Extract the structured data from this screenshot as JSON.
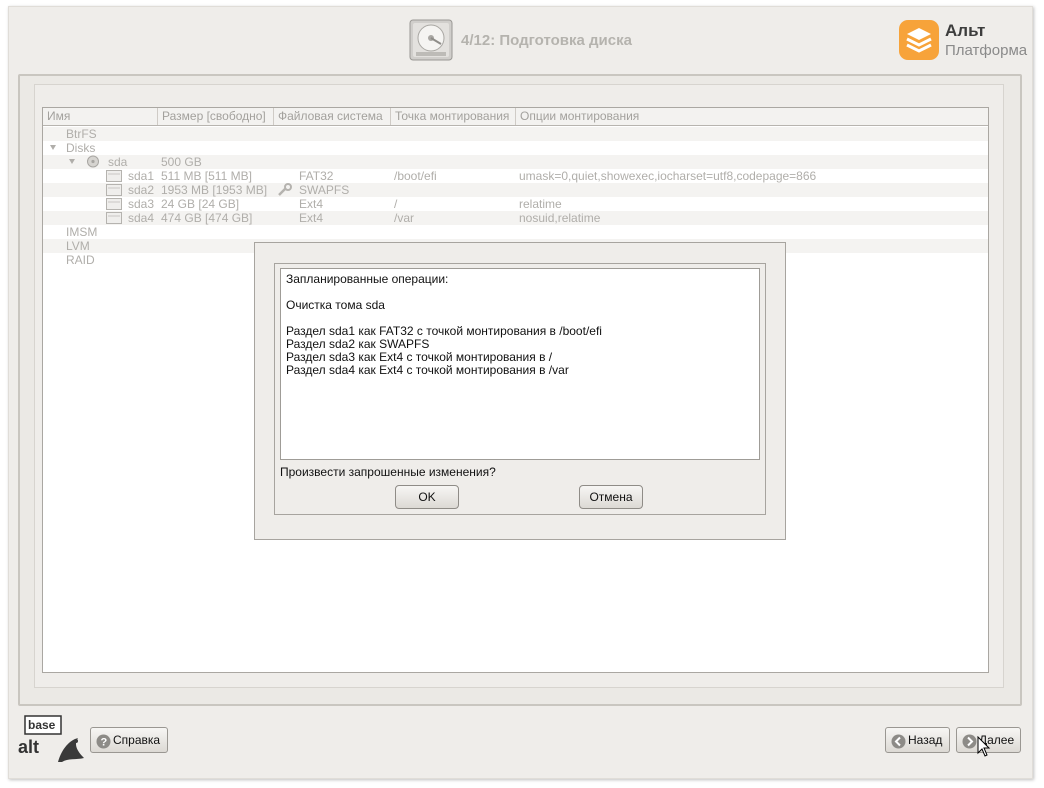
{
  "header": {
    "title": "4/12: Подготовка диска",
    "logo_line1": "Альт",
    "logo_line2": "Платформа"
  },
  "tree": {
    "columns": [
      "Имя",
      "Размер [свободно]",
      "Файловая система",
      "Точка монтирования",
      "Опции монтирования"
    ],
    "rows": [
      {
        "name": "BtrFS"
      },
      {
        "name": "Disks"
      },
      {
        "name": "sda",
        "size": "500 GB"
      },
      {
        "name": "sda1",
        "size": "511 MB [511 MB]",
        "fs": "FAT32",
        "mount": "/boot/efi",
        "options": "umask=0,quiet,showexec,iocharset=utf8,codepage=866"
      },
      {
        "name": "sda2",
        "size": "1953 MB [1953 MB]",
        "fs": "SWAPFS",
        "mount": "",
        "options": ""
      },
      {
        "name": "sda3",
        "size": "24 GB [24 GB]",
        "fs": "Ext4",
        "mount": "/",
        "options": "relatime"
      },
      {
        "name": "sda4",
        "size": "474 GB [474 GB]",
        "fs": "Ext4",
        "mount": "/var",
        "options": "nosuid,relatime"
      },
      {
        "name": "IMSM"
      },
      {
        "name": "LVM"
      },
      {
        "name": "RAID"
      }
    ]
  },
  "dialog": {
    "ops_title": "Запланированные операции:",
    "op_clear": "Очистка тома sda",
    "op_lines": [
      "Раздел sda1 как FAT32 с точкой монтирования в /boot/efi",
      "Раздел sda2 как SWAPFS",
      "Раздел sda3 как Ext4 с точкой монтирования в /",
      "Раздел sda4 как Ext4 с точкой монтирования в /var"
    ],
    "question": "Произвести запрошенные изменения?",
    "ok_label": "OK",
    "cancel_label": "Отмена"
  },
  "footer": {
    "help_label": "Справка",
    "back_label": "Назад",
    "next_label": "Далее",
    "brand_top": "base",
    "brand_bottom": "alt"
  },
  "colors": {
    "accent_orange": "#f7a33a",
    "window_bg": "#efedea",
    "disabled_text": "#b0aeaa"
  }
}
